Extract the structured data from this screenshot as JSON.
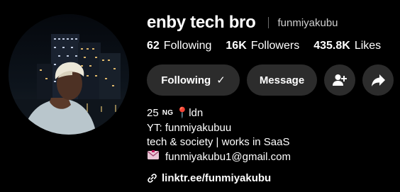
{
  "profile": {
    "display_name": "enby tech bro",
    "username": "funmiyakubu"
  },
  "stats": [
    {
      "value": "62",
      "label": "Following"
    },
    {
      "value": "16K",
      "label": "Followers"
    },
    {
      "value": "435.8K",
      "label": "Likes"
    }
  ],
  "actions": {
    "following_label": "Following",
    "following_check": "✓",
    "message_label": "Message",
    "add_friend_icon": "add-person-icon",
    "share_icon": "share-arrow-icon"
  },
  "bio": {
    "age": "25",
    "country": "NG",
    "location_icon": "📍",
    "location": "ldn",
    "line2": "YT: funmiyakubuu",
    "line3": "tech & society | works in SaaS",
    "email": "funmiyakubu1@gmail.com"
  },
  "link": {
    "url": "linktr.ee/funmiyakubu"
  },
  "colors": {
    "background": "#000000",
    "button": "#2c2c2c",
    "text": "#ffffff",
    "muted": "#cfcfcf"
  }
}
